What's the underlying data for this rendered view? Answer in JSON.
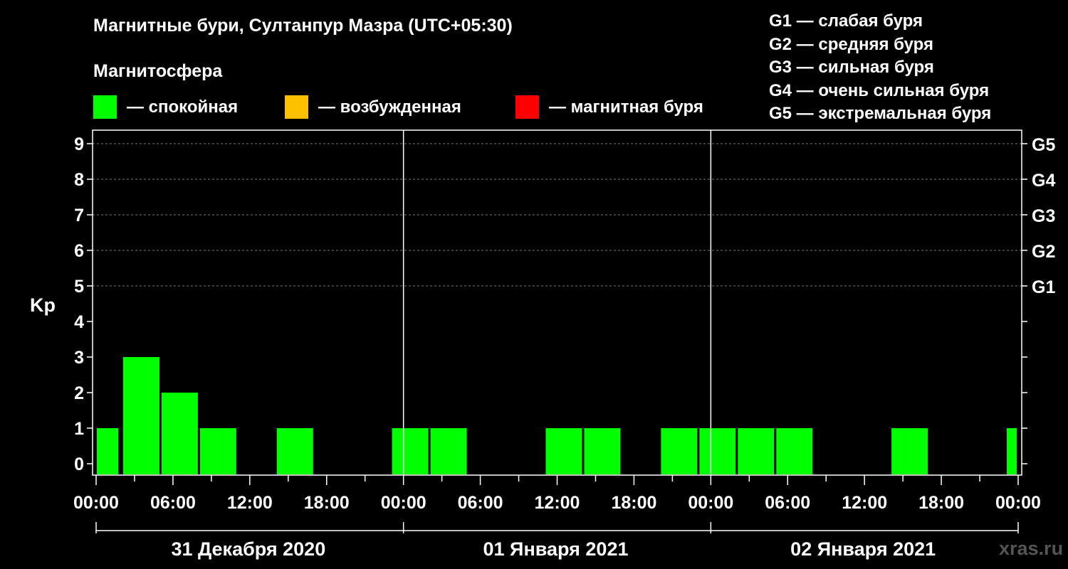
{
  "header": {
    "title": "Магнитные бури, Султанпур Мазра (UTC+05:30)",
    "legend_title": "Магнитосфера"
  },
  "legend": [
    {
      "label": "— спокойная",
      "color": "#00ff00"
    },
    {
      "label": "— возбужденная",
      "color": "#ffc000"
    },
    {
      "label": "— магнитная буря",
      "color": "#ff0000"
    }
  ],
  "storm_levels": [
    "G1 — слабая буря",
    "G2 — средняя буря",
    "G3 — сильная буря",
    "G4 — очень сильная буря",
    "G5 — экстремальная буря"
  ],
  "watermark": "xras.ru",
  "chart_data": {
    "type": "bar",
    "ylabel": "Kp",
    "ylim": [
      0,
      9
    ],
    "yticks": [
      0,
      1,
      2,
      3,
      4,
      5,
      6,
      7,
      8,
      9
    ],
    "y2ticks": [
      {
        "value": 5,
        "label": "G1"
      },
      {
        "value": 6,
        "label": "G2"
      },
      {
        "value": 7,
        "label": "G3"
      },
      {
        "value": 8,
        "label": "G4"
      },
      {
        "value": 9,
        "label": "G5"
      }
    ],
    "xlim_hours": [
      0,
      72
    ],
    "xtick_labels": [
      "00:00",
      "06:00",
      "12:00",
      "18:00",
      "00:00",
      "06:00",
      "12:00",
      "18:00",
      "00:00",
      "06:00",
      "12:00",
      "18:00",
      "00:00"
    ],
    "days": [
      "31 Декабря 2020",
      "01 Января 2021",
      "02 Января 2021"
    ],
    "bar_colors": {
      "quiet": "#00ff00",
      "active": "#ffc000",
      "storm": "#ff0000"
    },
    "bars": [
      {
        "start": 0,
        "end": 1.8,
        "kp": 1
      },
      {
        "start": 2,
        "end": 5,
        "kp": 3
      },
      {
        "start": 5,
        "end": 8,
        "kp": 2
      },
      {
        "start": 8,
        "end": 11,
        "kp": 1
      },
      {
        "start": 11,
        "end": 14,
        "kp": 0
      },
      {
        "start": 14,
        "end": 17,
        "kp": 1
      },
      {
        "start": 17,
        "end": 20,
        "kp": 0
      },
      {
        "start": 20,
        "end": 23,
        "kp": 0
      },
      {
        "start": 23,
        "end": 26,
        "kp": 1
      },
      {
        "start": 26,
        "end": 29,
        "kp": 1
      },
      {
        "start": 29,
        "end": 32,
        "kp": 0
      },
      {
        "start": 32,
        "end": 35,
        "kp": 0
      },
      {
        "start": 35,
        "end": 38,
        "kp": 1
      },
      {
        "start": 38,
        "end": 41,
        "kp": 1
      },
      {
        "start": 41,
        "end": 44,
        "kp": 0
      },
      {
        "start": 44,
        "end": 47,
        "kp": 1
      },
      {
        "start": 47,
        "end": 50,
        "kp": 1
      },
      {
        "start": 50,
        "end": 53,
        "kp": 1
      },
      {
        "start": 53,
        "end": 56,
        "kp": 1
      },
      {
        "start": 56,
        "end": 59,
        "kp": 0
      },
      {
        "start": 59,
        "end": 62,
        "kp": 0
      },
      {
        "start": 62,
        "end": 65,
        "kp": 1
      },
      {
        "start": 65,
        "end": 68,
        "kp": 0
      },
      {
        "start": 68,
        "end": 71,
        "kp": 0
      },
      {
        "start": 71,
        "end": 72,
        "kp": 1
      }
    ]
  }
}
